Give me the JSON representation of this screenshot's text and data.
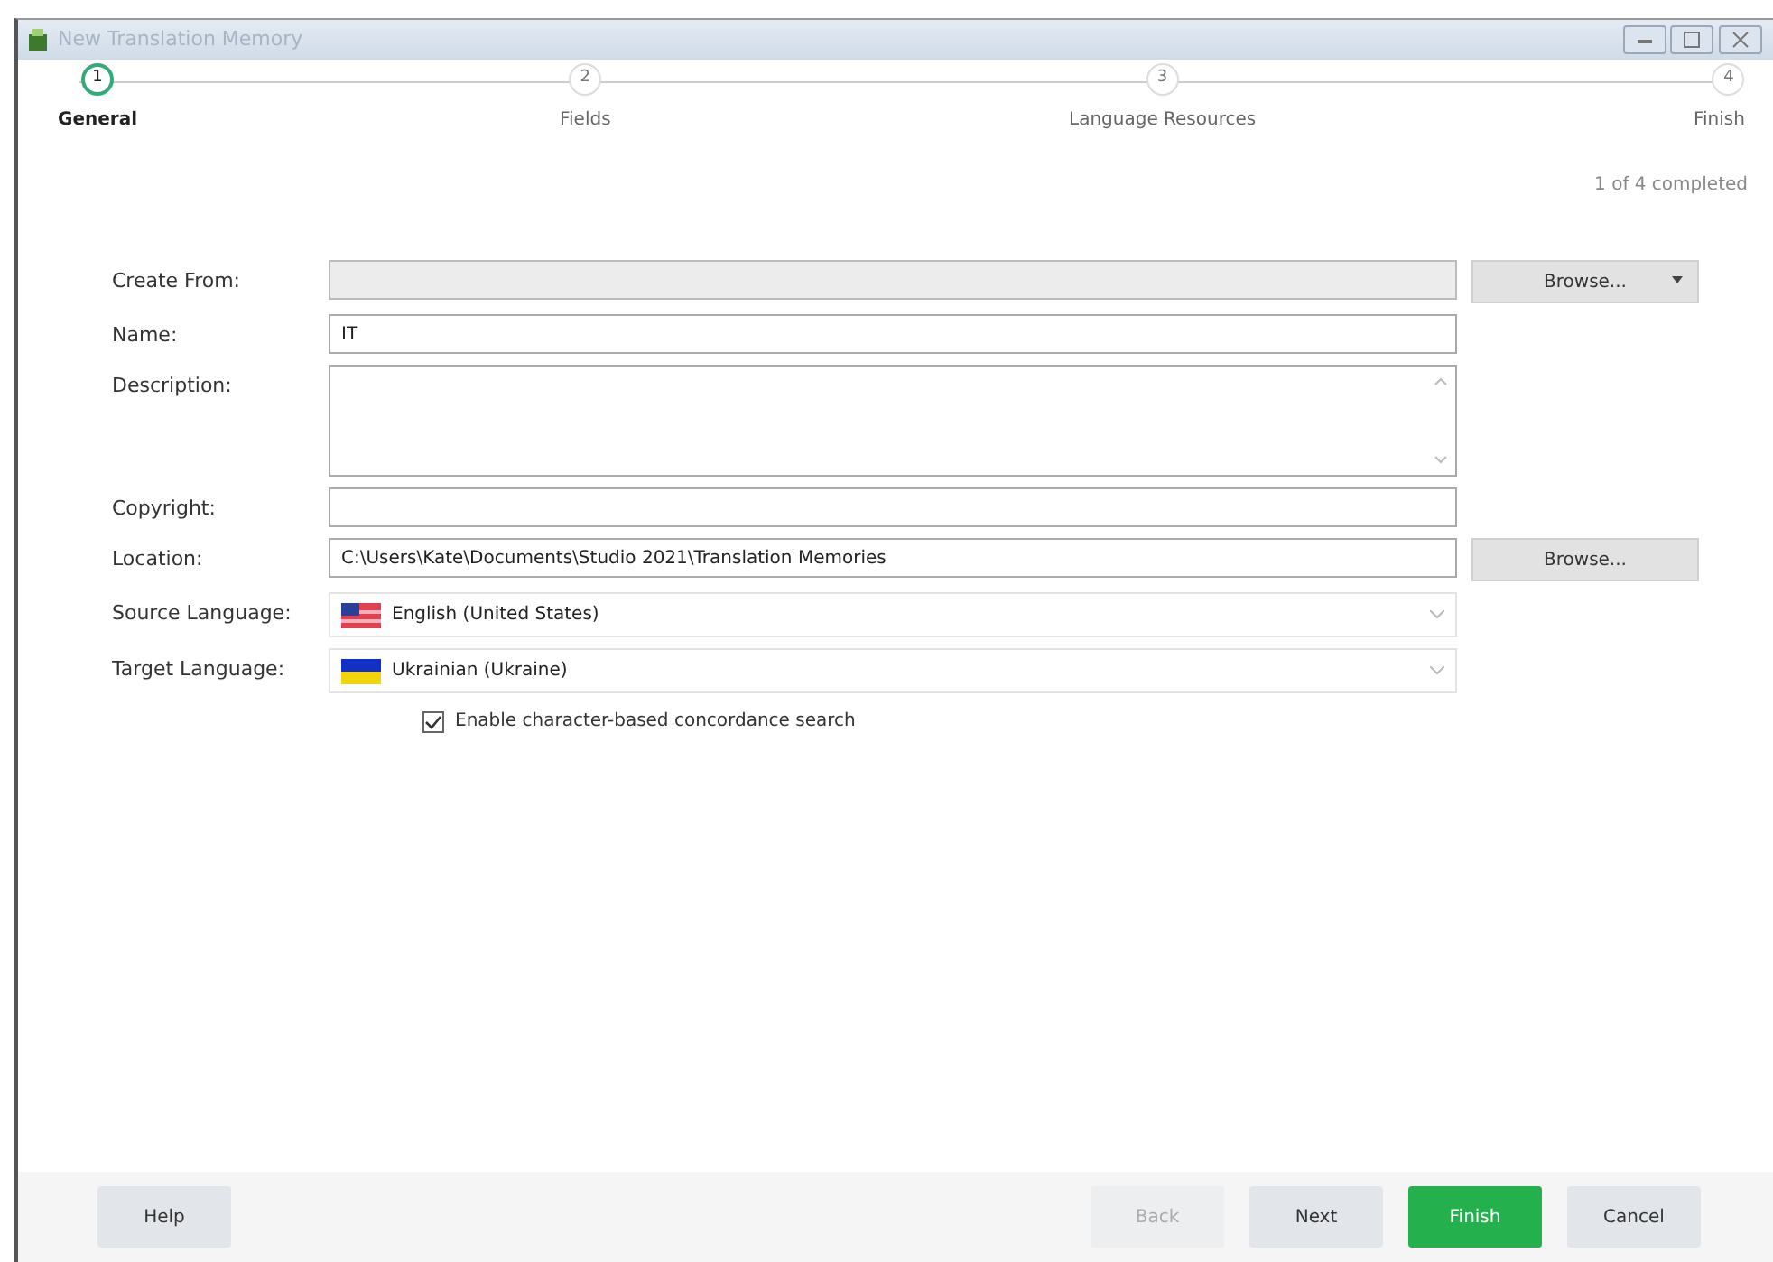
{
  "window": {
    "title": "New Translation Memory"
  },
  "steps": [
    {
      "number": "1",
      "label": "General",
      "selected": true
    },
    {
      "number": "2",
      "label": "Fields",
      "selected": false
    },
    {
      "number": "3",
      "label": "Language Resources",
      "selected": false
    },
    {
      "number": "4",
      "label": "Finish",
      "selected": false
    }
  ],
  "progress": "1 of 4 completed",
  "fields": [
    {
      "kind": "input",
      "label": "Create From:",
      "disabled": true,
      "button": "Browse...",
      "button_dropdown": true
    },
    {
      "kind": "input",
      "label": "Name:",
      "value": "IT"
    },
    {
      "kind": "textarea",
      "label": "Description:"
    },
    {
      "kind": "input",
      "label": "Copyright:"
    },
    {
      "kind": "input",
      "label": "Location:",
      "value": "C:\\Users\\Kate\\Documents\\Studio 2021\\Translation Memories",
      "button": "Browse..."
    },
    {
      "kind": "select",
      "label": "Source Language:",
      "value": "English (United States)"
    },
    {
      "kind": "select",
      "label": "Target Language:",
      "value": "Ukrainian (Ukraine)"
    }
  ],
  "checkbox": {
    "label": "Enable character-based concordance search",
    "checked": true
  },
  "buttons": [
    {
      "label": "Help",
      "disabled": false,
      "primary": false
    },
    {
      "label": "Back",
      "disabled": true,
      "primary": false
    },
    {
      "label": "Next",
      "disabled": false,
      "primary": false
    },
    {
      "label": "Finish",
      "disabled": false,
      "primary": true
    },
    {
      "label": "Cancel",
      "disabled": false,
      "primary": false
    }
  ]
}
